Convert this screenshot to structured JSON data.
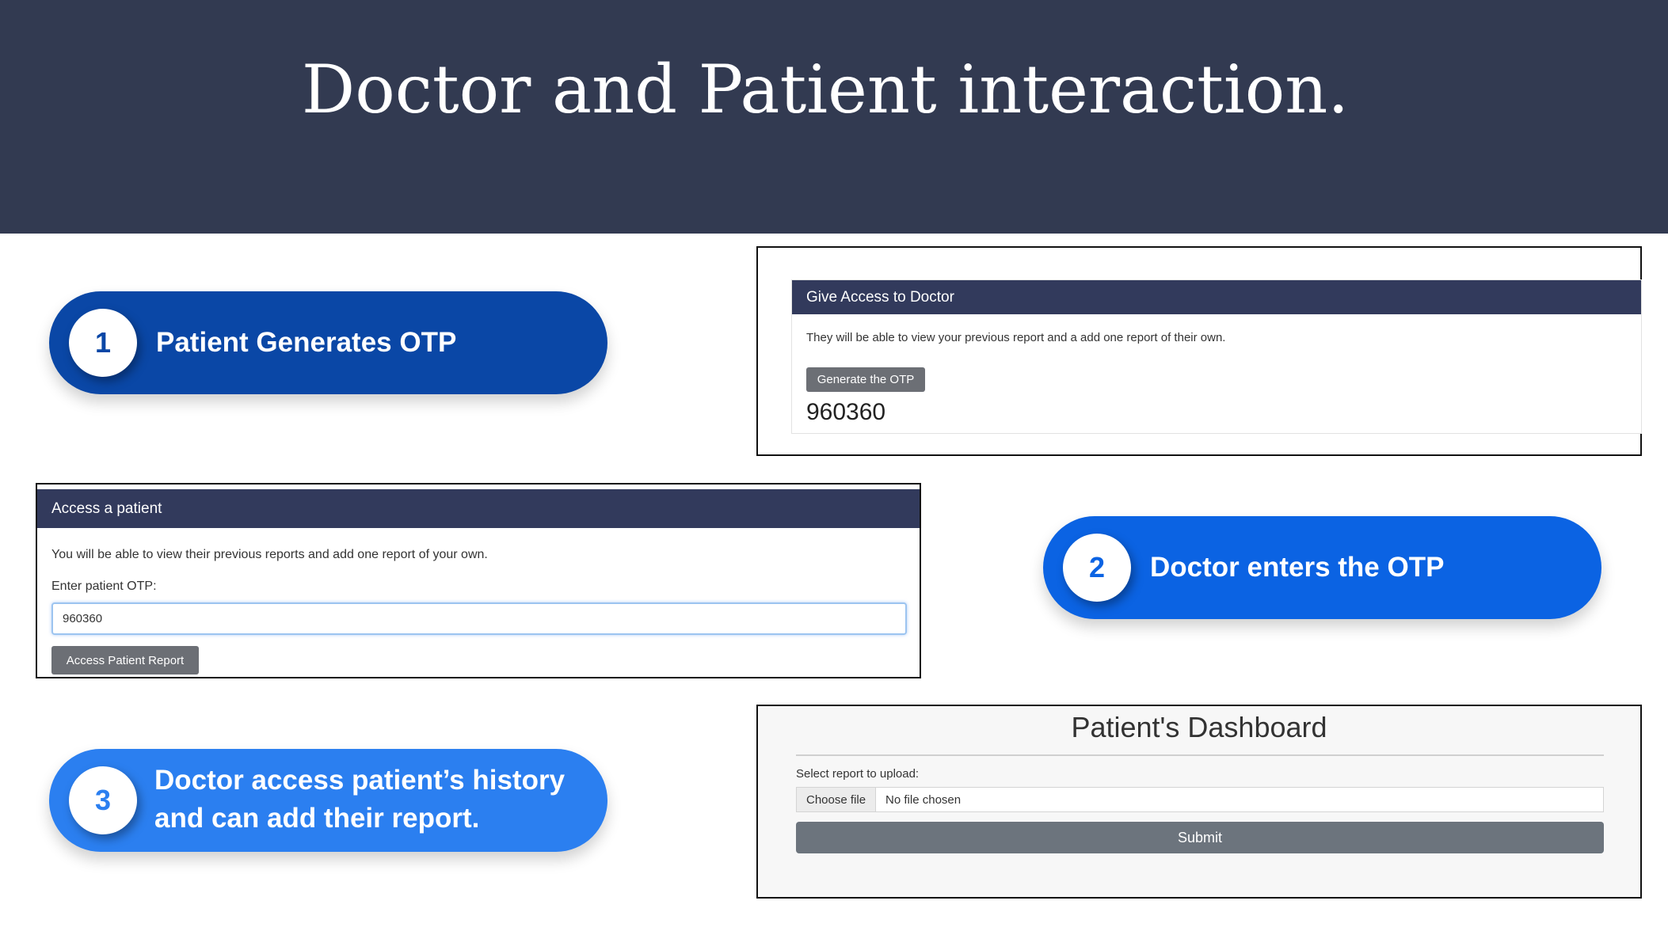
{
  "slide": {
    "title": "Doctor and Patient interaction."
  },
  "steps": [
    {
      "number": "1",
      "text": "Patient Generates OTP",
      "color": "#0a47a6"
    },
    {
      "number": "2",
      "text": "Doctor enters the OTP",
      "color": "#0b63e3"
    },
    {
      "number": "3",
      "text": "Doctor access patient’s history and can add their report.",
      "color": "#2b7ff0"
    }
  ],
  "give_access": {
    "header": "Give Access to Doctor",
    "description": "They will be able to view your previous report and a add one report of their own.",
    "button": "Generate the OTP",
    "otp": "960360"
  },
  "access_patient": {
    "header": "Access a patient",
    "description": "You will be able to view their previous reports and add one report of your own.",
    "otp_label": "Enter patient OTP:",
    "otp_value": "960360",
    "button": "Access Patient Report"
  },
  "dashboard": {
    "title": "Patient's Dashboard",
    "upload_label": "Select report to upload:",
    "choose_file": "Choose file",
    "file_status": "No file chosen",
    "submit": "Submit"
  },
  "colors": {
    "header_bg": "#323a51",
    "card_header_bg": "#323a5c",
    "button_gray": "#6c6f75"
  }
}
